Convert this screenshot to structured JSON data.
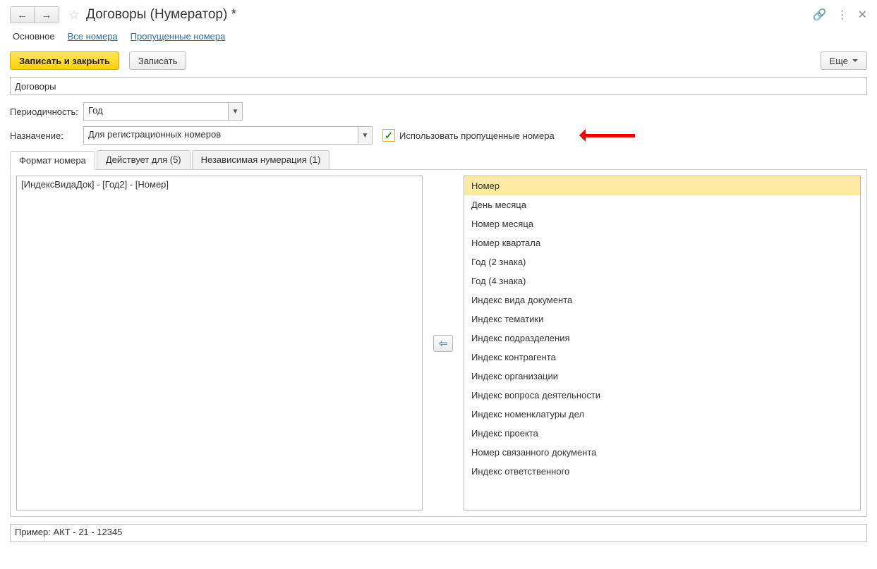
{
  "title": "Договоры (Нумератор) *",
  "navlinks": {
    "main": "Основное",
    "all_numbers": "Все номера",
    "skipped_numbers": "Пропущенные номера"
  },
  "toolbar": {
    "save_close": "Записать и закрыть",
    "save": "Записать",
    "more": "Еще"
  },
  "name_field": {
    "value": "Договоры"
  },
  "periodicity": {
    "label": "Периодичность:",
    "value": "Год"
  },
  "purpose": {
    "label": "Назначение:",
    "value": "Для регистрационных номеров"
  },
  "use_skipped": {
    "label": "Использовать пропущенные номера",
    "checked": true
  },
  "tabs": {
    "format": "Формат номера",
    "applies": "Действует для (5)",
    "independent": "Независимая нумерация (1)"
  },
  "format_value": "[ИндексВидаДок] - [Год2] - [Номер]",
  "tokens": [
    "Номер",
    "День месяца",
    "Номер месяца",
    "Номер квартала",
    "Год (2 знака)",
    "Год (4 знака)",
    "Индекс вида документа",
    "Индекс тематики",
    "Индекс подразделения",
    "Индекс контрагента",
    "Индекс организации",
    "Индекс вопроса деятельности",
    "Индекс номенклатуры дел",
    "Индекс проекта",
    "Номер связанного документа",
    "Индекс ответственного"
  ],
  "example": "Пример:  АКТ - 21 - 12345"
}
